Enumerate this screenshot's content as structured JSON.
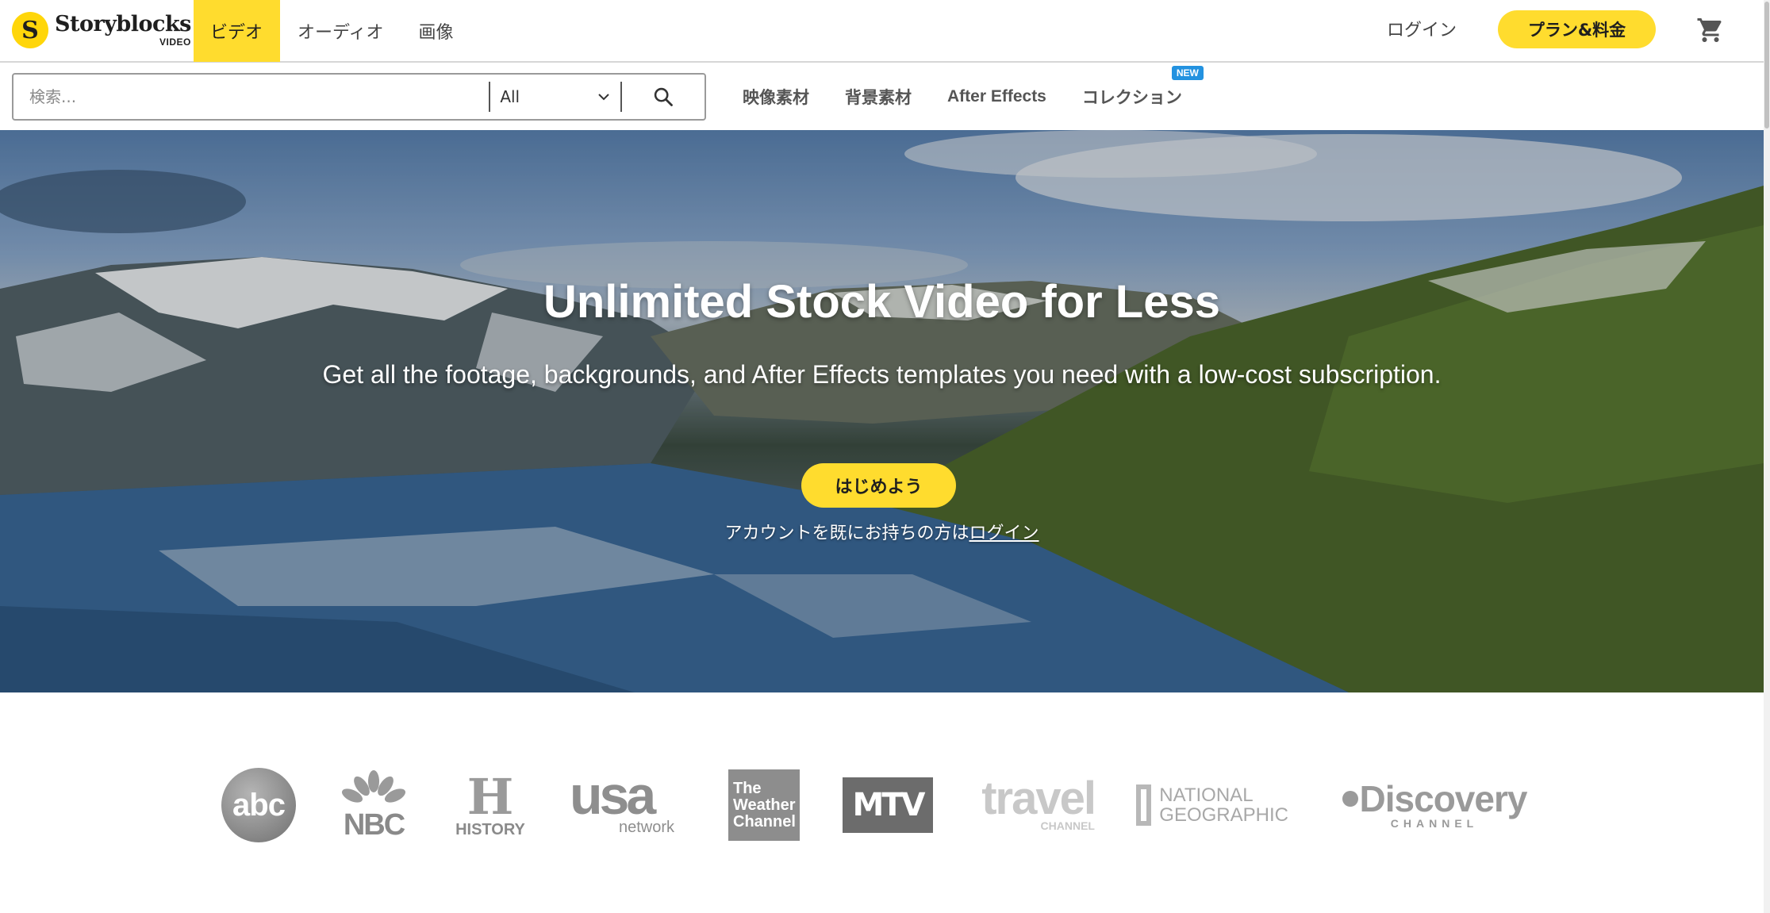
{
  "brand": {
    "name": "Storyblocks",
    "sub": "VIDEO",
    "mark": "S"
  },
  "top_tabs": [
    {
      "label": "ビデオ",
      "active": true
    },
    {
      "label": "オーディオ",
      "active": false
    },
    {
      "label": "画像",
      "active": false
    }
  ],
  "header": {
    "login_label": "ログイン",
    "plan_label": "プラン&料金",
    "cart_icon": "cart-icon"
  },
  "search": {
    "placeholder": "検索...",
    "value": "",
    "category": "All",
    "search_icon": "search-icon"
  },
  "subnav": [
    {
      "label": "映像素材"
    },
    {
      "label": "背景素材"
    },
    {
      "label": "After Effects"
    },
    {
      "label": "コレクション",
      "badge": "NEW"
    }
  ],
  "hero": {
    "title": "Unlimited Stock Video for Less",
    "subtitle": "Get all the footage, backgrounds, and After Effects templates you need with a low-cost subscription.",
    "cta_label": "はじめよう",
    "login_prompt_prefix": "アカウントを既にお持ちの方は",
    "login_link": "ログイン"
  },
  "partner_logos": {
    "abc": "abc",
    "nbc": "NBC",
    "history": "HISTORY",
    "usa_main": "usa",
    "usa_sub": "network",
    "weather_1": "The",
    "weather_2": "Weather",
    "weather_3": "Channel",
    "mtv": "MTV",
    "travel_main": "travel",
    "travel_sub": "CHANNEL",
    "natgeo_1": "NATIONAL",
    "natgeo_2": "GEOGRAPHIC",
    "discovery_main": "Discovery",
    "discovery_sub": "CHANNEL"
  },
  "colors": {
    "accent": "#ffdc2e",
    "badge": "#2392e0",
    "logo_gray": "#8e8e8e"
  }
}
